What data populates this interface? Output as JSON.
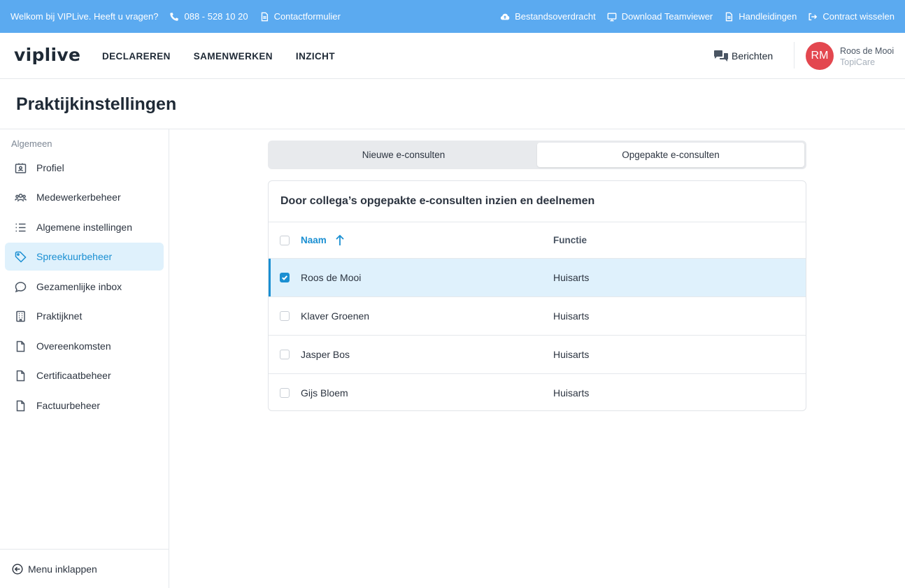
{
  "topbar": {
    "welcome": "Welkom bij VIPLive. Heeft u vragen?",
    "phone": "088 - 528 10 20",
    "contact": "Contactformulier",
    "links": [
      {
        "label": "Bestandsoverdracht",
        "icon": "cloud-upload-icon"
      },
      {
        "label": "Download Teamviewer",
        "icon": "monitor-icon"
      },
      {
        "label": "Handleidingen",
        "icon": "document-icon"
      },
      {
        "label": "Contract wisselen",
        "icon": "switch-icon"
      }
    ],
    "color": "#5baaf0"
  },
  "header": {
    "logo": "viplive",
    "nav": [
      "DECLAREREN",
      "SAMENWERKEN",
      "INZICHT"
    ],
    "messages": "Berichten",
    "avatar_initials": "RM",
    "avatar_color": "#e3474f",
    "user_name": "Roos de Mooi",
    "user_org": "TopiCare"
  },
  "page": {
    "title": "Praktijkinstellingen"
  },
  "sidebar": {
    "section": "Algemeen",
    "items": [
      {
        "label": "Profiel",
        "icon": "id-card-icon"
      },
      {
        "label": "Medewerkerbeheer",
        "icon": "users-icon"
      },
      {
        "label": "Algemene instellingen",
        "icon": "list-icon"
      },
      {
        "label": "Spreekuurbeheer",
        "icon": "tag-icon",
        "active": true
      },
      {
        "label": "Gezamenlijke inbox",
        "icon": "chat-bubble-icon"
      },
      {
        "label": "Praktijknet",
        "icon": "building-icon"
      },
      {
        "label": "Overeenkomsten",
        "icon": "file-icon"
      },
      {
        "label": "Certificaatbeheer",
        "icon": "file-icon"
      },
      {
        "label": "Factuurbeheer",
        "icon": "file-icon"
      }
    ],
    "collapse": "Menu inklappen",
    "active_color": "#1a8fd2"
  },
  "tabs": [
    {
      "label": "Nieuwe e-consulten",
      "active": false
    },
    {
      "label": "Opgepakte e-consulten",
      "active": true
    }
  ],
  "card": {
    "title": "Door collega’s opgepakte e-consulten inzien en deelnemen",
    "columns": {
      "name": "Naam",
      "function": "Functie"
    },
    "sort": "ascending",
    "rows": [
      {
        "name": "Roos de Mooi",
        "function": "Huisarts",
        "checked": true
      },
      {
        "name": "Klaver Groenen",
        "function": "Huisarts",
        "checked": false
      },
      {
        "name": "Jasper Bos",
        "function": "Huisarts",
        "checked": false
      },
      {
        "name": "Gijs Bloem",
        "function": "Huisarts",
        "checked": false
      }
    ]
  }
}
